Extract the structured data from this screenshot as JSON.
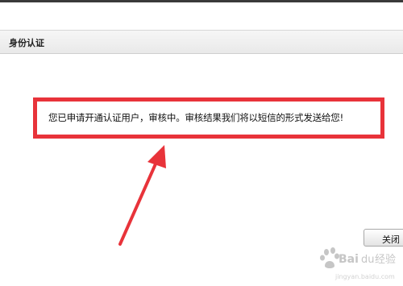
{
  "dialog": {
    "title": "身份认证",
    "message": "您已申请开通认证用户，审核中。审核结果我们将以短信的形式发送给您!",
    "close_label": "关闭"
  },
  "annotation": {
    "highlight_color": "#e8333a",
    "arrow_color": "#e8333a"
  },
  "watermark": {
    "logo_text": "Baidu 经验",
    "logo_color": "#c6c6c6"
  }
}
